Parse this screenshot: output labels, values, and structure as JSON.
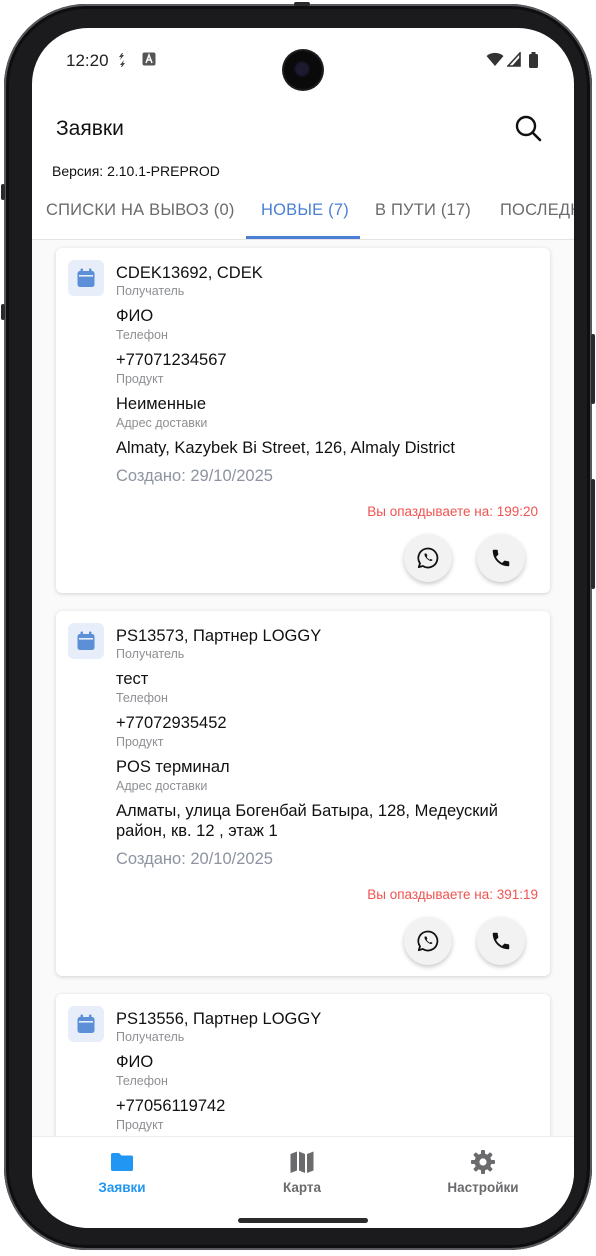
{
  "status_bar": {
    "time": "12:20"
  },
  "app_bar": {
    "title": "Заявки",
    "version": "Версия: 2.10.1-PREPROD"
  },
  "tabs": [
    {
      "label": "СПИСКИ НА ВЫВОЗ (0)"
    },
    {
      "label": "НОВЫЕ (7)"
    },
    {
      "label": "В ПУТИ (17)"
    },
    {
      "label": "ПОСЛЕДН"
    }
  ],
  "orders": [
    {
      "title": "CDEK13692, CDEK",
      "recipient_label": "Получатель",
      "recipient": "ФИО",
      "phone_label": "Телефон",
      "phone": "+77071234567",
      "product_label": "Продукт",
      "product": "Неименные",
      "address_label": "Адрес доставки",
      "address": "Almaty, Kazybek Bi Street, 126, Almaly District",
      "created": "Создано: 29/10/2025",
      "late": "Вы опаздываете на: 199:20"
    },
    {
      "title": "PS13573, Партнер LOGGY",
      "recipient_label": "Получатель",
      "recipient": "тест",
      "phone_label": "Телефон",
      "phone": "+77072935452",
      "product_label": "Продукт",
      "product": "POS терминал",
      "address_label": "Адрес доставки",
      "address": "Алматы, улица Богенбай Батыра, 128, Медеуский район, кв. 12 , этаж 1",
      "created": "Создано: 20/10/2025",
      "late": "Вы опаздываете на: 391:19"
    },
    {
      "title": "PS13556, Партнер LOGGY",
      "recipient_label": "Получатель",
      "recipient": "ФИО",
      "phone_label": "Телефон",
      "phone": "+77056119742",
      "product_label": "Продукт"
    }
  ],
  "bottom_nav": [
    {
      "label": "Заявки",
      "icon": "folder-icon"
    },
    {
      "label": "Карта",
      "icon": "map-icon"
    },
    {
      "label": "Настройки",
      "icon": "gear-icon"
    }
  ],
  "colors": {
    "accent": "#4a7fd4",
    "nav_active": "#2196f3",
    "late": "#ef5350",
    "icon_bg": "#e7eef9"
  }
}
